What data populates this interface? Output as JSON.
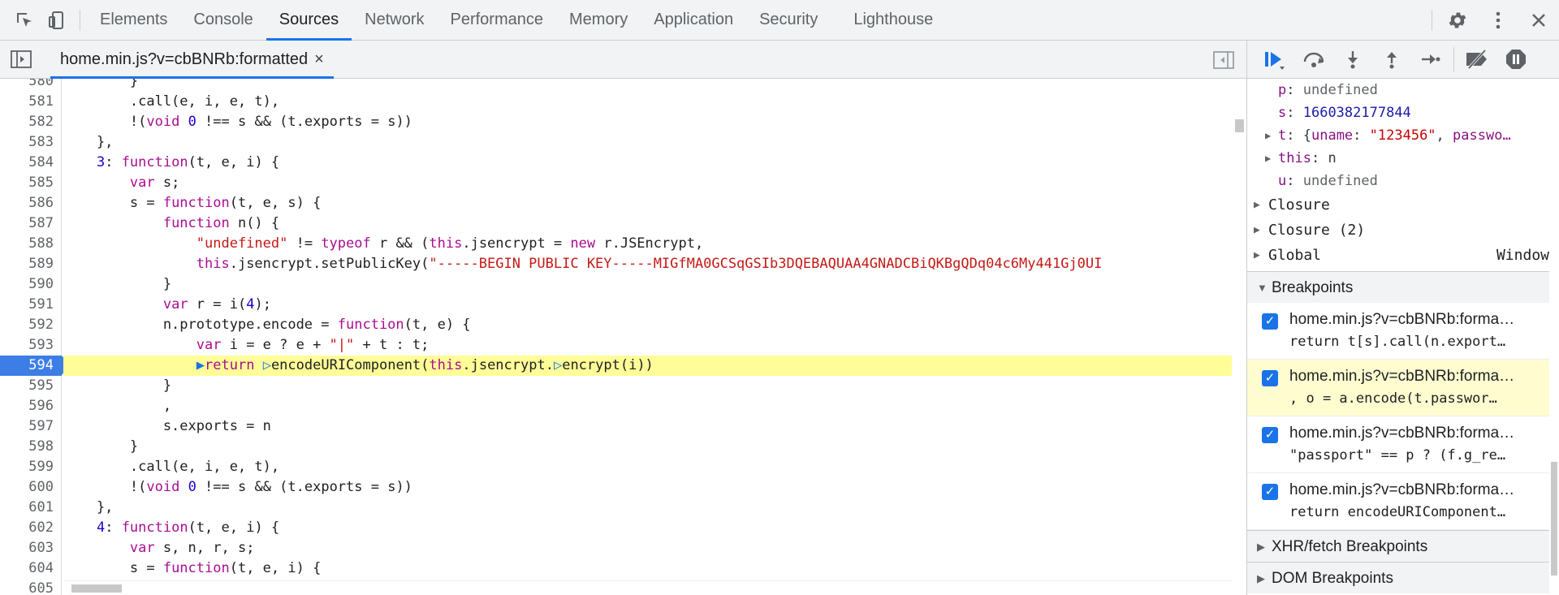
{
  "toolbar": {
    "tabs": [
      "Elements",
      "Console",
      "Sources",
      "Network",
      "Performance",
      "Memory",
      "Application",
      "Security",
      "Lighthouse"
    ],
    "active_tab": "Sources"
  },
  "file_tab": {
    "label": "home.min.js?v=cbBNRb:formatted",
    "close": "×"
  },
  "editor": {
    "lines": [
      {
        "n": "580",
        "code": "        }"
      },
      {
        "n": "581",
        "code": "        .call(e, i, e, t),"
      },
      {
        "n": "582",
        "code": "        !(void 0 !== s && (t.exports = s))"
      },
      {
        "n": "583",
        "code": "    },"
      },
      {
        "n": "584",
        "code": "    3: function(t, e, i) {"
      },
      {
        "n": "585",
        "code": "        var s;"
      },
      {
        "n": "586",
        "code": "        s = function(t, e, s) {"
      },
      {
        "n": "587",
        "code": "            function n() {"
      },
      {
        "n": "588",
        "code": "                \"undefined\" != typeof r && (this.jsencrypt = new r.JSEncrypt,"
      },
      {
        "n": "589",
        "code": "                this.jsencrypt.setPublicKey(\"-----BEGIN PUBLIC KEY-----MIGfMA0GCSqGSIb3DQEBAQUAA4GNADCBiQKBgQDq04c6My441Gj0UI"
      },
      {
        "n": "590",
        "code": "            }"
      },
      {
        "n": "591",
        "code": "            var r = i(4);"
      },
      {
        "n": "592",
        "code": "            n.prototype.encode = function(t, e) {"
      },
      {
        "n": "593",
        "code": "                var i = e ? e + \"|\" + t : t;"
      },
      {
        "n": "594",
        "code": "                ▶return ▷encodeURIComponent(this.jsencrypt.▷encrypt(i))",
        "current": true
      },
      {
        "n": "595",
        "code": "            }"
      },
      {
        "n": "596",
        "code": "            ,"
      },
      {
        "n": "597",
        "code": "            s.exports = n"
      },
      {
        "n": "598",
        "code": "        }"
      },
      {
        "n": "599",
        "code": "        .call(e, i, e, t),"
      },
      {
        "n": "600",
        "code": "        !(void 0 !== s && (t.exports = s))"
      },
      {
        "n": "601",
        "code": "    },"
      },
      {
        "n": "602",
        "code": "    4: function(t, e, i) {"
      },
      {
        "n": "603",
        "code": "        var s, n, r, s;"
      },
      {
        "n": "604",
        "code": "        s = function(t, e, i) {"
      },
      {
        "n": "605",
        "code": ""
      }
    ]
  },
  "scope": {
    "vars": [
      {
        "key": "p",
        "value": "undefined",
        "expandable": false,
        "kind": "undef"
      },
      {
        "key": "s",
        "value": "1660382177844",
        "expandable": false,
        "kind": "num"
      },
      {
        "key": "t",
        "value": "{uname: \"123456\", passwo…",
        "expandable": true,
        "kind": "obj"
      },
      {
        "key": "this",
        "value": "n",
        "expandable": true,
        "kind": "plain"
      },
      {
        "key": "u",
        "value": "undefined",
        "expandable": false,
        "kind": "undef"
      }
    ],
    "groups": [
      {
        "label": "Closure",
        "right": ""
      },
      {
        "label": "Closure (2)",
        "right": ""
      },
      {
        "label": "Global",
        "right": "Window"
      }
    ]
  },
  "breakpoints": {
    "title": "Breakpoints",
    "items": [
      {
        "file": "home.min.js?v=cbBNRb:forma…",
        "code": "return t[s].call(n.export…",
        "checked": true,
        "paused": false
      },
      {
        "file": "home.min.js?v=cbBNRb:forma…",
        "code": ", o = a.encode(t.passwor…",
        "checked": true,
        "paused": true
      },
      {
        "file": "home.min.js?v=cbBNRb:forma…",
        "code": "\"passport\" == p ? (f.g_re…",
        "checked": true,
        "paused": false
      },
      {
        "file": "home.min.js?v=cbBNRb:forma…",
        "code": "return encodeURIComponent…",
        "checked": true,
        "paused": false
      }
    ]
  },
  "sections": {
    "xhr": "XHR/fetch Breakpoints",
    "dom": "DOM Breakpoints"
  }
}
